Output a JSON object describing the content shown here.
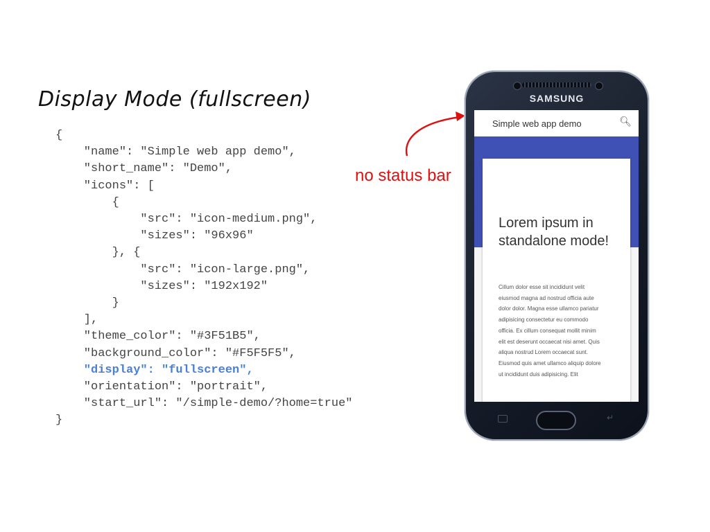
{
  "slide": {
    "title": "Display Mode (fullscreen)",
    "annotation": "no status bar"
  },
  "code_lines": [
    "{",
    "    \"name\": \"Simple web app demo\",",
    "    \"short_name\": \"Demo\",",
    "    \"icons\": [",
    "        {",
    "            \"src\": \"icon-medium.png\",",
    "            \"sizes\": \"96x96\"",
    "        }, {",
    "            \"src\": \"icon-large.png\",",
    "            \"sizes\": \"192x192\"",
    "        }",
    "    ],",
    "    \"theme_color\": \"#3F51B5\",",
    "    \"background_color\": \"#F5F5F5\",",
    "    \"display\": \"fullscreen\",",
    "    \"orientation\": \"portrait\",",
    "    \"start_url\": \"/simple-demo/?home=true\"",
    "}"
  ],
  "highlight_line": 14,
  "phone": {
    "brand": "SAMSUNG",
    "app_title": "Simple web app demo",
    "search_icon": "search-icon",
    "card_heading": "Lorem ipsum in standalone mode!",
    "card_body": "Cillum dolor esse sit incididunt velit eiusmod magna ad nostrud officia aute dolor dolor. Magna esse ullamco pariatur adipisicing consectetur eu commodo officia. Ex cillum consequat mollit minim elit est deserunt occaecat nisi amet. Quis aliqua nostrud Lorem occaecat sunt. Eiusmod quis amet ullamco aliquip dolore ut incididunt duis adipisicing. Elit"
  },
  "colors": {
    "theme": "#3F51B5",
    "background": "#F5F5F5",
    "annotation": "#DD1111",
    "highlight": "#4A7FD4"
  }
}
